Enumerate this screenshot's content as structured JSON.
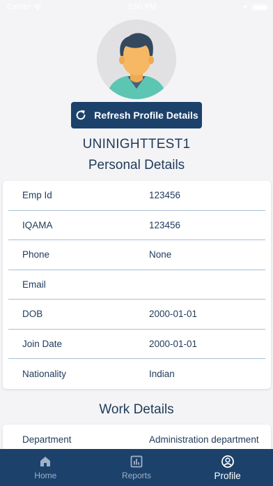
{
  "status_bar": {
    "carrier": "Carrier",
    "time": "2:50 PM"
  },
  "profile": {
    "refresh_label": "Refresh Profile Details",
    "username": "UNINIGHTTEST1"
  },
  "personal": {
    "title": "Personal Details",
    "rows": [
      {
        "label": "Emp Id",
        "value": "123456"
      },
      {
        "label": "IQAMA",
        "value": "123456"
      },
      {
        "label": "Phone",
        "value": "None"
      },
      {
        "label": "Email",
        "value": ""
      },
      {
        "label": "DOB",
        "value": "2000-01-01"
      },
      {
        "label": "Join Date",
        "value": "2000-01-01"
      },
      {
        "label": "Nationality",
        "value": "Indian"
      }
    ]
  },
  "work": {
    "title": "Work Details",
    "rows": [
      {
        "label": "Department",
        "value": "Administration department"
      }
    ]
  },
  "nav": {
    "items": [
      {
        "label": "Home",
        "icon": "home-icon"
      },
      {
        "label": "Reports",
        "icon": "reports-icon"
      },
      {
        "label": "Profile",
        "icon": "profile-icon",
        "active": true
      }
    ]
  },
  "colors": {
    "primary": "#1c416b",
    "text": "#1f3a5a",
    "divider": "#a9bfd6"
  }
}
